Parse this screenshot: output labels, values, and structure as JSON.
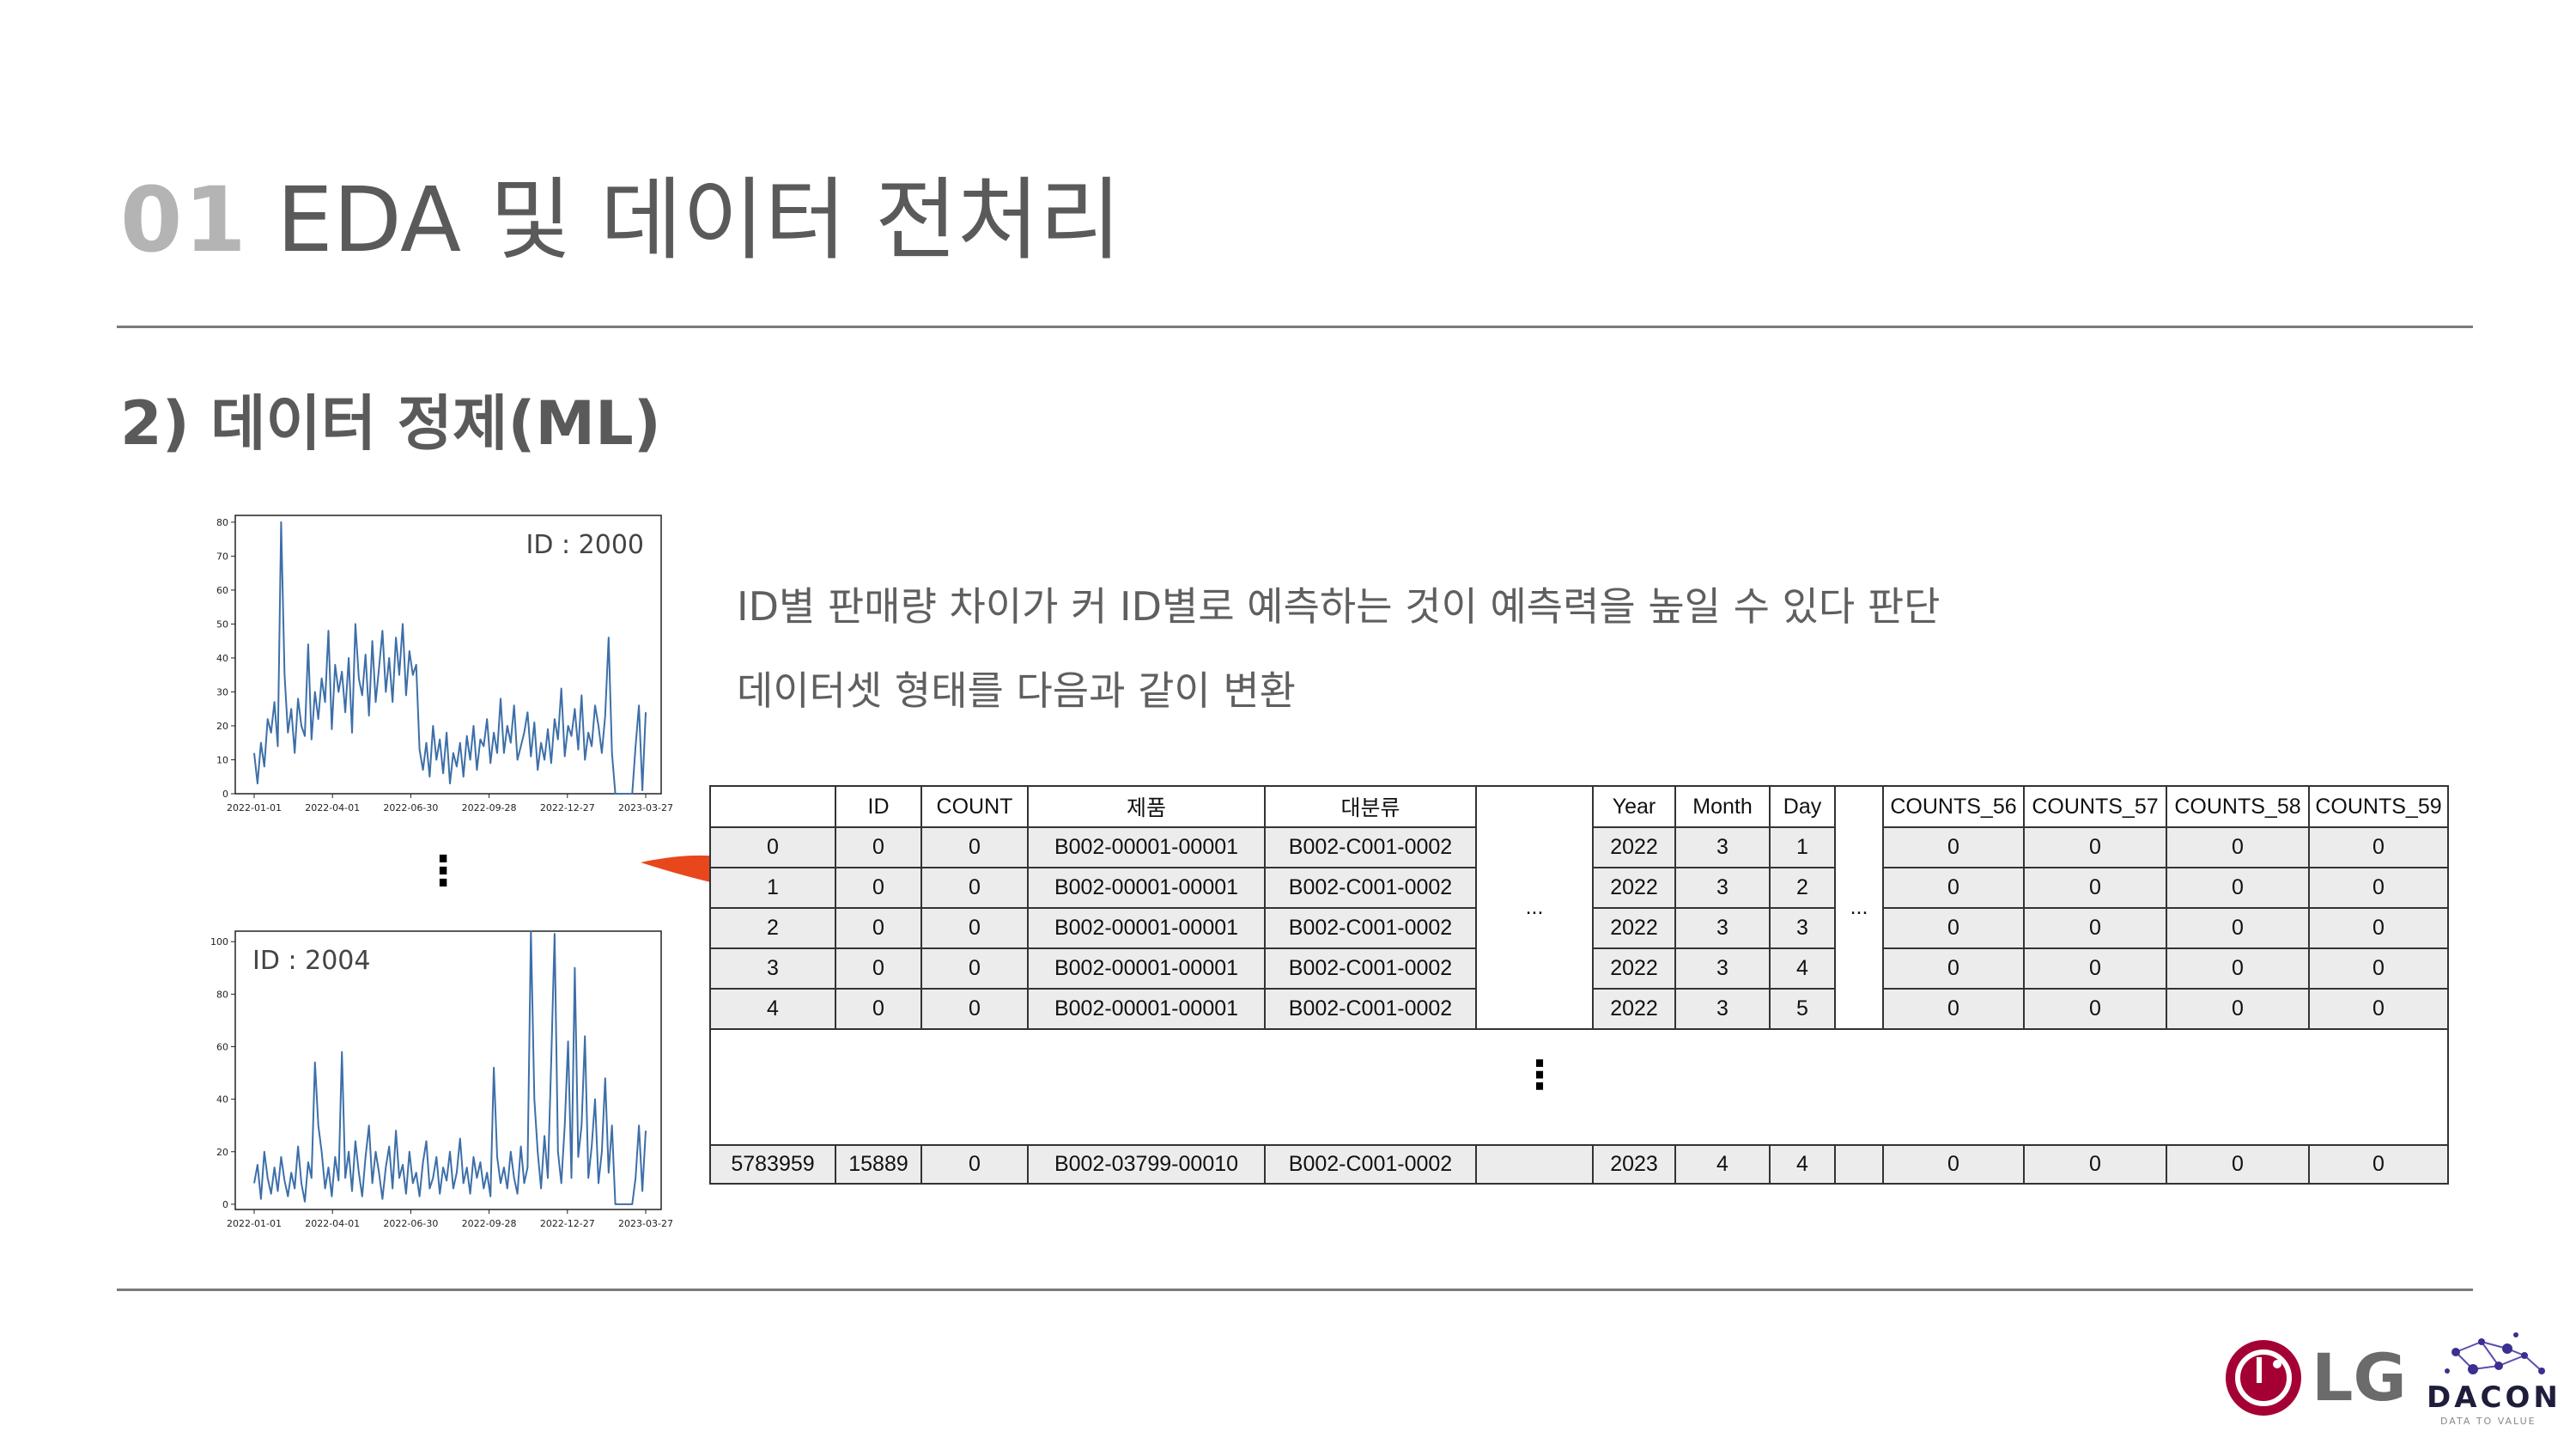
{
  "header": {
    "number": "01",
    "title": "EDA 및 데이터 전처리"
  },
  "section": {
    "title": "2) 데이터 정제(ML)"
  },
  "description": {
    "line1": "ID별 판매량 차이가 커 ID별로 예측하는 것이 예측력을 높일 수 있다 판단",
    "line2": "데이터셋 형태를 다음과 같이 변환"
  },
  "charts_labels": {
    "ellipsis": "⋮"
  },
  "chart_data": [
    {
      "type": "line",
      "annotation": "ID : 2000",
      "x_ticks": [
        "2022-01-01",
        "2022-04-01",
        "2022-06-30",
        "2022-09-28",
        "2022-12-27",
        "2023-03-27"
      ],
      "y_ticks": [
        0,
        10,
        20,
        30,
        40,
        50,
        60,
        70,
        80
      ],
      "ylim": [
        0,
        82
      ],
      "color": "#3d6fa8",
      "values": [
        12,
        3,
        15,
        8,
        22,
        18,
        27,
        14,
        80,
        35,
        18,
        25,
        12,
        28,
        20,
        17,
        44,
        16,
        30,
        22,
        34,
        27,
        48,
        19,
        38,
        30,
        36,
        24,
        40,
        18,
        50,
        34,
        29,
        41,
        23,
        45,
        27,
        37,
        48,
        30,
        40,
        27,
        46,
        35,
        50,
        29,
        42,
        35,
        38,
        13,
        7,
        15,
        5,
        20,
        10,
        16,
        6,
        18,
        3,
        12,
        8,
        15,
        5,
        17,
        10,
        20,
        7,
        16,
        14,
        22,
        9,
        18,
        12,
        28,
        12,
        20,
        15,
        26,
        10,
        14,
        18,
        24,
        11,
        21,
        7,
        15,
        10,
        19,
        9,
        22,
        16,
        31,
        11,
        20,
        17,
        25,
        13,
        29,
        10,
        18,
        14,
        26,
        20,
        12,
        23,
        46,
        12,
        0,
        0,
        0,
        0,
        0,
        0,
        14,
        26,
        1,
        24
      ]
    },
    {
      "type": "line",
      "annotation": "ID : 2004",
      "x_ticks": [
        "2022-01-01",
        "2022-04-01",
        "2022-06-30",
        "2022-09-28",
        "2022-12-27",
        "2023-03-27"
      ],
      "y_ticks": [
        0,
        20,
        40,
        60,
        80,
        100
      ],
      "ylim": [
        -2,
        104
      ],
      "color": "#3d6fa8",
      "values": [
        8,
        15,
        2,
        20,
        10,
        4,
        14,
        5,
        18,
        9,
        3,
        12,
        6,
        22,
        8,
        1,
        16,
        10,
        54,
        30,
        20,
        6,
        14,
        3,
        18,
        9,
        58,
        10,
        20,
        5,
        24,
        12,
        3,
        18,
        30,
        8,
        20,
        12,
        2,
        14,
        22,
        6,
        28,
        10,
        15,
        4,
        20,
        8,
        12,
        3,
        16,
        24,
        6,
        10,
        18,
        4,
        14,
        9,
        20,
        6,
        12,
        25,
        8,
        14,
        4,
        18,
        10,
        16,
        6,
        12,
        3,
        52,
        18,
        8,
        14,
        6,
        20,
        10,
        4,
        22,
        8,
        14,
        104,
        40,
        20,
        6,
        26,
        10,
        54,
        103,
        20,
        8,
        30,
        62,
        10,
        90,
        18,
        30,
        64,
        10,
        22,
        40,
        8,
        20,
        48,
        12,
        30,
        0,
        0,
        0,
        0,
        0,
        0,
        10,
        30,
        5,
        28
      ]
    }
  ],
  "table": {
    "columns": [
      "",
      "ID",
      "COUNT",
      "제품",
      "대분류",
      "",
      "Year",
      "Month",
      "Day",
      "",
      "COUNTS_56",
      "COUNTS_57",
      "COUNTS_58",
      "COUNTS_59"
    ],
    "rows": [
      [
        "0",
        "0",
        "0",
        "B002-00001-00001",
        "B002-C001-0002",
        "2022",
        "3",
        "1",
        "0",
        "0",
        "0",
        "0"
      ],
      [
        "1",
        "0",
        "0",
        "B002-00001-00001",
        "B002-C001-0002",
        "2022",
        "3",
        "2",
        "0",
        "0",
        "0",
        "0"
      ],
      [
        "2",
        "0",
        "0",
        "B002-00001-00001",
        "B002-C001-0002",
        "2022",
        "3",
        "3",
        "0",
        "0",
        "0",
        "0"
      ],
      [
        "3",
        "0",
        "0",
        "B002-00001-00001",
        "B002-C001-0002",
        "2022",
        "3",
        "4",
        "0",
        "0",
        "0",
        "0"
      ],
      [
        "4",
        "0",
        "0",
        "B002-00001-00001",
        "B002-C001-0002",
        "2022",
        "3",
        "5",
        "0",
        "0",
        "0",
        "0"
      ]
    ],
    "ellipsis_h": "...",
    "ellipsis_v": "⋮",
    "last_row": [
      "5783959",
      "15889",
      "0",
      "B002-03799-00010",
      "B002-C001-0002",
      "2023",
      "4",
      "4",
      "0",
      "0",
      "0",
      "0"
    ]
  },
  "logos": {
    "lg_text": "LG",
    "dacon_text": "DACON",
    "dacon_tagline": "DATA TO VALUE",
    "lg_color": "#a50034"
  },
  "colors": {
    "title_number": "#b4b4b4",
    "arrow": "#e8471c",
    "table_body": "#ececec"
  }
}
